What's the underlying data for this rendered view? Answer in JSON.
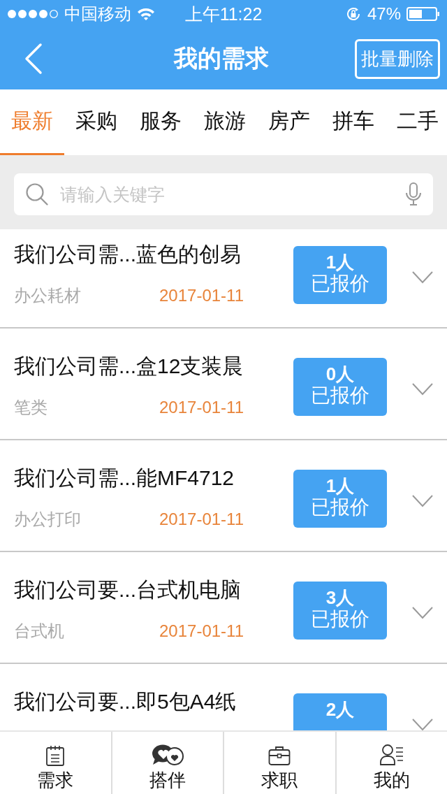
{
  "status_bar": {
    "carrier": "中国移动",
    "time": "上午11:22",
    "battery": "47%"
  },
  "nav": {
    "title": "我的需求",
    "action": "批量删除"
  },
  "tabs": [
    {
      "label": "最新",
      "selected": true
    },
    {
      "label": "采购",
      "selected": false
    },
    {
      "label": "服务",
      "selected": false
    },
    {
      "label": "旅游",
      "selected": false
    },
    {
      "label": "房产",
      "selected": false
    },
    {
      "label": "拼车",
      "selected": false
    },
    {
      "label": "二手",
      "selected": false
    }
  ],
  "search": {
    "placeholder": "请输入关键字"
  },
  "rows": [
    {
      "title": "我们公司需...蓝色的创易",
      "category": "办公耗材",
      "date": "2017-01-11",
      "count": "1人",
      "label": "已报价"
    },
    {
      "title": "我们公司需...盒12支装晨",
      "category": "笔类",
      "date": "2017-01-11",
      "count": "0人",
      "label": "已报价"
    },
    {
      "title": "我们公司需...能MF4712",
      "category": "办公打印",
      "date": "2017-01-11",
      "count": "1人",
      "label": "已报价"
    },
    {
      "title": "我们公司要...台式机电脑",
      "category": "台式机",
      "date": "2017-01-11",
      "count": "3人",
      "label": "已报价"
    },
    {
      "title": "我们公司要...即5包A4纸",
      "count": "2人"
    }
  ],
  "tab_bar": [
    {
      "label": "需求",
      "kind": "notepad"
    },
    {
      "label": "搭伴",
      "kind": "hearts"
    },
    {
      "label": "求职",
      "kind": "briefcase"
    },
    {
      "label": "我的",
      "kind": "profile"
    }
  ]
}
